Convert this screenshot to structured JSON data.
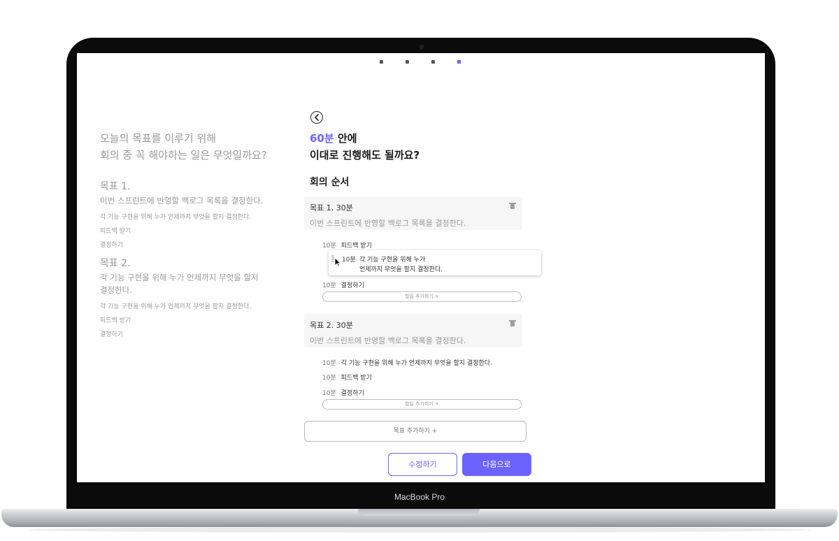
{
  "device": {
    "label": "MacBook Pro"
  },
  "colors": {
    "accent": "#6c63ff",
    "muted": "#9a9a9a",
    "text": "#1a1a1a"
  },
  "pager": {
    "total": 4,
    "active": 4
  },
  "left_panel": {
    "question_line1": "오늘의 목표를 이루기 위해",
    "question_line2": "회의 중 꼭 해야하는 일은 무엇일까요?",
    "goals": [
      {
        "title": "목표 1.",
        "desc": "이번 스프린트에 반영할 백로그 목록을 결정한다.",
        "subs": [
          "각 기능 구현을 위해 누가 언제까지 무엇을 할지 결정한다.",
          "피드백 받기",
          "결정하기"
        ]
      },
      {
        "title": "목표 2.",
        "desc": "각 기능 구현을 위해 누가 언제까지 무엇을 할지 결정한다.",
        "subs": [
          "각 기능 구현을 위해 누가 언제까지 무엇을 할지 결정한다.",
          "피드백 받기",
          "결정하기"
        ]
      }
    ]
  },
  "header": {
    "back_icon": "back-arrow-circle-icon",
    "minutes": "60분",
    "line1_suffix": " 안에",
    "line2": "이대로 진행해도 될까요?"
  },
  "agenda": {
    "title": "회의 순서",
    "goals": [
      {
        "title": "목표 1. 30분",
        "desc": "이번 스프린트에 반영할 백로그 목록을 결정한다.",
        "items": [
          {
            "min": "10분",
            "text": "피드백 받기"
          },
          {
            "min": "10분",
            "text": "결정하기"
          }
        ],
        "dragging": {
          "min": "10분",
          "line1": "각 기능 구현을 위해 누가",
          "line2": "언제까지 무엇을 할지 결정한다."
        },
        "add_label": "할일 추가하기 +"
      },
      {
        "title": "목표 2. 30분",
        "desc": "이번 스프린트에 반영할 백로그 목록을 결정한다.",
        "items": [
          {
            "min": "10분",
            "text": "각 기능 구현을 위해 누가 언제까지 무엇을 할지 결정한다."
          },
          {
            "min": "10분",
            "text": "피드백 받기"
          },
          {
            "min": "10분",
            "text": "결정하기"
          }
        ],
        "add_label": "할일 추가하기 +"
      }
    ],
    "add_goal_label": "목표 추가하기 +"
  },
  "actions": {
    "edit_label": "수정하기",
    "next_label": "다음으로"
  }
}
